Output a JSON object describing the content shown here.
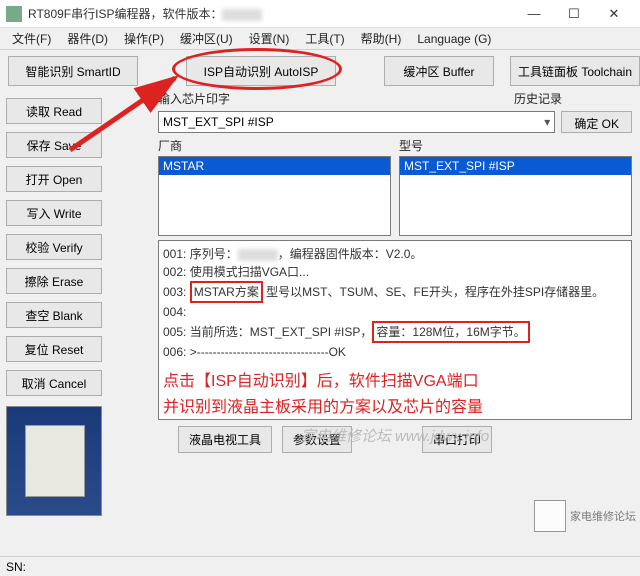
{
  "title": "RT809F串行ISP编程器，软件版本：",
  "menu": [
    "文件(F)",
    "器件(D)",
    "操作(P)",
    "缓冲区(U)",
    "设置(N)",
    "工具(T)",
    "帮助(H)",
    "Language (G)"
  ],
  "topButtons": {
    "smartid": "智能识别 SmartID",
    "autoisp": "ISP自动识别 AutoISP",
    "buffer": "缓冲区 Buffer",
    "toolchain": "工具链面板 Toolchain"
  },
  "sideButtons": {
    "read": "读取 Read",
    "save": "保存 Save",
    "open": "打开 Open",
    "write": "写入 Write",
    "verify": "校验 Verify",
    "erase": "擦除 Erase",
    "blank": "查空 Blank",
    "reset": "复位 Reset",
    "cancel": "取消 Cancel"
  },
  "labels": {
    "chipInput": "输入芯片印字",
    "history": "历史记录",
    "ok": "确定 OK",
    "vendor": "厂商",
    "model": "型号"
  },
  "chipCombo": "MST_EXT_SPI #ISP",
  "vendorItem": "MSTAR",
  "modelItem": "MST_EXT_SPI #ISP",
  "log": {
    "l1a": "001:  序列号：",
    "l1b": "，编程器固件版本：V2.0。",
    "l2": "002:  使用模式扫描VGA口...",
    "l3a": "003:  ",
    "l3box": "MSTAR方案",
    "l3b": "  型号以MST、TSUM、SE、FE开头，程序在外挂SPI存储器里。",
    "l4": "004:",
    "l5a": "005:  当前所选：MST_EXT_SPI #ISP，",
    "l5box": "容量：128M位，16M字节。",
    "l6": "006:  >---------------------------------OK"
  },
  "annot": {
    "line1": "点击【ISP自动识别】后，软件扫描VGA端口",
    "line2": "并识别到液晶主板采用的方案以及芯片的容量"
  },
  "watermark": "家电维修论坛   www.jdwx.info",
  "bottomButtons": {
    "lcdtool": "液晶电视工具",
    "param": "参数设置",
    "serial": "串口打印"
  },
  "status": "SN:",
  "qrText": "家电维修论坛"
}
